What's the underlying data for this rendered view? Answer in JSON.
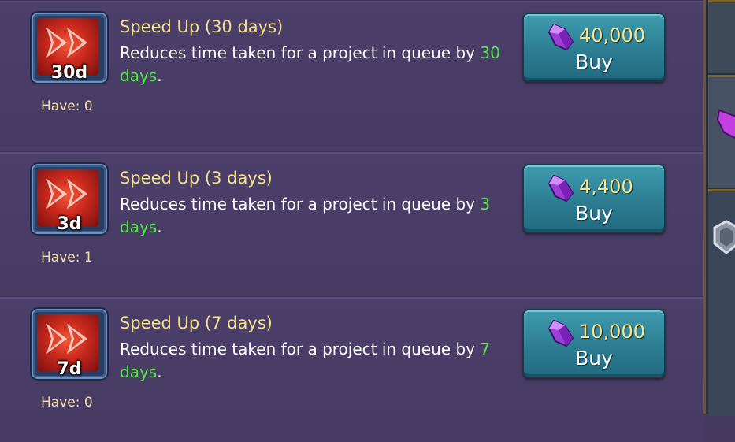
{
  "items": [
    {
      "icon_label": "3d",
      "title": "Speed Up (3 days)",
      "desc_prefix": "Reduces time taken for a project in queue by ",
      "desc_highlight": "3 days",
      "desc_suffix": ".",
      "have": "Have: 1",
      "price": "4,400",
      "buy_label": "Buy"
    },
    {
      "icon_label": "7d",
      "title": "Speed Up (7 days)",
      "desc_prefix": "Reduces time taken for a project in queue by ",
      "desc_highlight": "7 days",
      "desc_suffix": ".",
      "have": "Have: 0",
      "price": "10,000",
      "buy_label": "Buy"
    },
    {
      "icon_label": "30d",
      "title": "Speed Up (30 days)",
      "desc_prefix": "Reduces time taken for a project in queue by ",
      "desc_highlight": "30 days",
      "desc_suffix": ".",
      "have": "Have: 0",
      "price": "40,000",
      "buy_label": "Buy"
    }
  ],
  "icons": {
    "item": "speed-up-icon",
    "currency": "gem-icon"
  },
  "colors": {
    "title": "#f4e28a",
    "highlight": "#55e34a",
    "button": "#2c7d92",
    "panel": "#4a3d66"
  }
}
